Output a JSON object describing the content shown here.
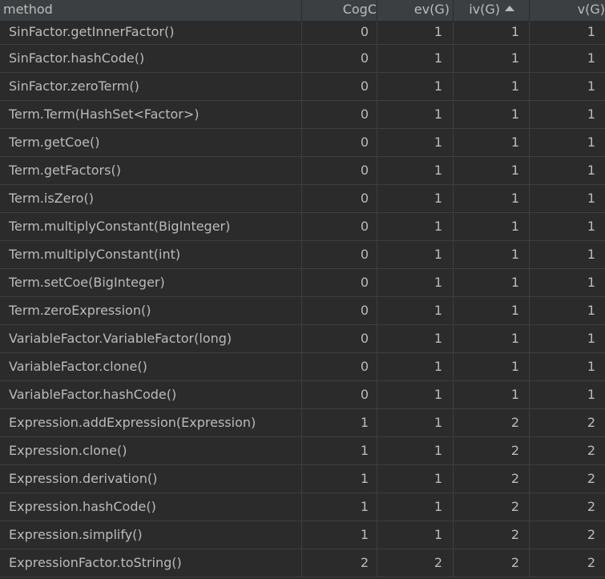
{
  "columns": {
    "method": "method",
    "cogc": "CogC",
    "ev": "ev(G)",
    "iv": "iv(G)",
    "v": "v(G)"
  },
  "sort": {
    "column": "iv",
    "direction": "ascending",
    "icon": "sort-ascending-icon"
  },
  "colors": {
    "background": "#2b2b2b",
    "header": "#3c3f41",
    "text": "#bbbbbb"
  },
  "rows": [
    {
      "method": "SinFactor.getInnerFactor()",
      "cogc": "0",
      "ev": "1",
      "iv": "1",
      "v": "1"
    },
    {
      "method": "SinFactor.hashCode()",
      "cogc": "0",
      "ev": "1",
      "iv": "1",
      "v": "1"
    },
    {
      "method": "SinFactor.zeroTerm()",
      "cogc": "0",
      "ev": "1",
      "iv": "1",
      "v": "1"
    },
    {
      "method": "Term.Term(HashSet<Factor>)",
      "cogc": "0",
      "ev": "1",
      "iv": "1",
      "v": "1"
    },
    {
      "method": "Term.getCoe()",
      "cogc": "0",
      "ev": "1",
      "iv": "1",
      "v": "1"
    },
    {
      "method": "Term.getFactors()",
      "cogc": "0",
      "ev": "1",
      "iv": "1",
      "v": "1"
    },
    {
      "method": "Term.isZero()",
      "cogc": "0",
      "ev": "1",
      "iv": "1",
      "v": "1"
    },
    {
      "method": "Term.multiplyConstant(BigInteger)",
      "cogc": "0",
      "ev": "1",
      "iv": "1",
      "v": "1"
    },
    {
      "method": "Term.multiplyConstant(int)",
      "cogc": "0",
      "ev": "1",
      "iv": "1",
      "v": "1"
    },
    {
      "method": "Term.setCoe(BigInteger)",
      "cogc": "0",
      "ev": "1",
      "iv": "1",
      "v": "1"
    },
    {
      "method": "Term.zeroExpression()",
      "cogc": "0",
      "ev": "1",
      "iv": "1",
      "v": "1"
    },
    {
      "method": "VariableFactor.VariableFactor(long)",
      "cogc": "0",
      "ev": "1",
      "iv": "1",
      "v": "1"
    },
    {
      "method": "VariableFactor.clone()",
      "cogc": "0",
      "ev": "1",
      "iv": "1",
      "v": "1"
    },
    {
      "method": "VariableFactor.hashCode()",
      "cogc": "0",
      "ev": "1",
      "iv": "1",
      "v": "1"
    },
    {
      "method": "Expression.addExpression(Expression)",
      "cogc": "1",
      "ev": "1",
      "iv": "2",
      "v": "2"
    },
    {
      "method": "Expression.clone()",
      "cogc": "1",
      "ev": "1",
      "iv": "2",
      "v": "2"
    },
    {
      "method": "Expression.derivation()",
      "cogc": "1",
      "ev": "1",
      "iv": "2",
      "v": "2"
    },
    {
      "method": "Expression.hashCode()",
      "cogc": "1",
      "ev": "1",
      "iv": "2",
      "v": "2"
    },
    {
      "method": "Expression.simplify()",
      "cogc": "1",
      "ev": "1",
      "iv": "2",
      "v": "2"
    },
    {
      "method": "ExpressionFactor.toString()",
      "cogc": "2",
      "ev": "2",
      "iv": "2",
      "v": "2"
    }
  ]
}
